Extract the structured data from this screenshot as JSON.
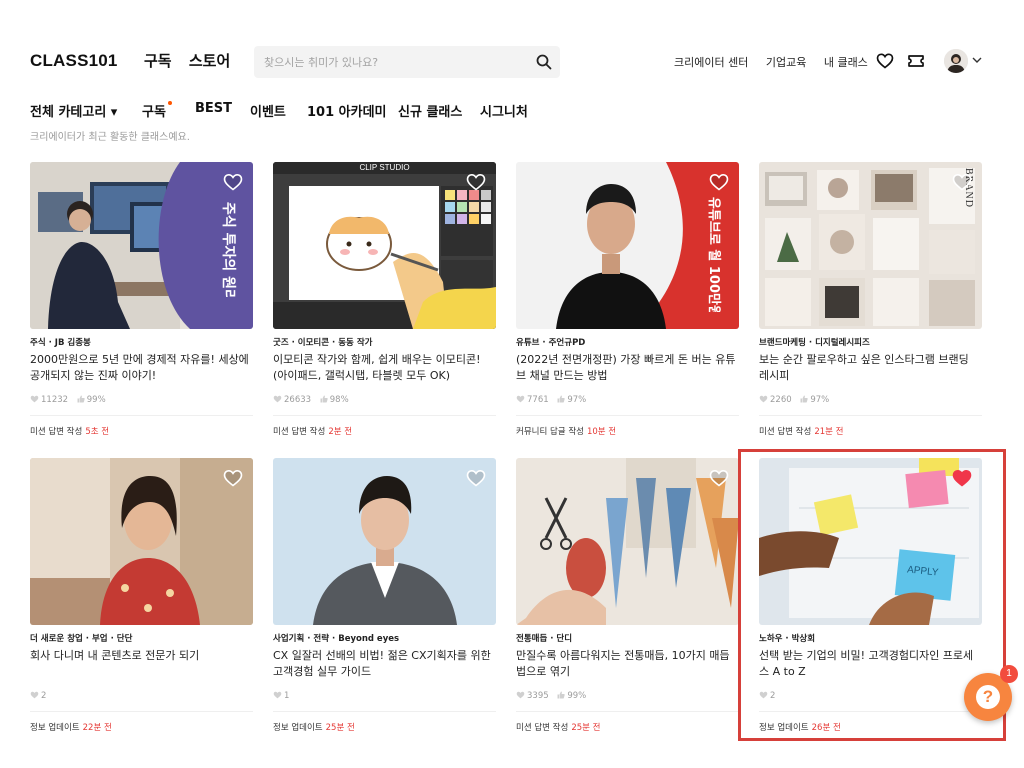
{
  "header": {
    "logo": "CLASS101",
    "nav": [
      "구독",
      "스토어"
    ],
    "search_placeholder": "찾으시는 취미가 있나요?",
    "right_links": [
      "크리에이터 센터",
      "기업교육",
      "내 클래스"
    ]
  },
  "categories": {
    "items": [
      "전체 카테고리 ▾",
      "구독",
      "BEST",
      "이벤트",
      "101 아카데미",
      "신규 클래스",
      "시그니처"
    ],
    "subtitle": "크리에이터가 최근 활동한 클래스예요."
  },
  "cards": [
    {
      "creator": "주식 · JB 김종봉",
      "title": "2000만원으로 5년 만에 경제적 자유를! 세상에 공개되지 않는 진짜 이야기!",
      "likes": "11232",
      "rate": "99%",
      "status": "미션 답변 작성",
      "ago": "5초 전",
      "overlay": "주식 투자의 원리",
      "liked": false
    },
    {
      "creator": "굿즈 · 이모티콘 · 동동 작가",
      "title": "이모티콘 작가와 함께, 쉽게 배우는 이모티콘! (아이패드, 갤럭시탭, 타블렛 모두 OK)",
      "likes": "26633",
      "rate": "98%",
      "status": "미션 답변 작성",
      "ago": "2분 전",
      "overlay": "CLIP STUDIO",
      "liked": false
    },
    {
      "creator": "유튜브 · 주언규PD",
      "title": "(2022년 전면개정판) 가장 빠르게 돈 버는 유튜브 채널 만드는 방법",
      "likes": "7761",
      "rate": "97%",
      "status": "커뮤니티 답글 작성",
      "ago": "10분 전",
      "overlay": "유튜브로 월 100만원",
      "liked": false
    },
    {
      "creator": "브랜드마케팅 · 디지털레시피즈",
      "title": "보는 순간 팔로우하고 싶은 인스타그램 브랜딩 레시피",
      "likes": "2260",
      "rate": "97%",
      "status": "미션 답변 작성",
      "ago": "21분 전",
      "overlay": "BRAND",
      "liked": false
    },
    {
      "creator": "더 새로운 창업 · 부업 · 단단",
      "title": "회사 다니며 내 콘텐츠로 전문가 되기",
      "likes": "2",
      "rate": "",
      "status": "정보 업데이트",
      "ago": "22분 전",
      "overlay": "",
      "liked": false
    },
    {
      "creator": "사업기획 · 전략 · Beyond eyes",
      "title": "CX 일잘러 선배의 비법! 젊은 CX기획자를 위한 고객경험 실무 가이드",
      "likes": "1",
      "rate": "",
      "status": "정보 업데이트",
      "ago": "25분 전",
      "overlay": "",
      "liked": false
    },
    {
      "creator": "전통매듭 · 단디",
      "title": "만질수록 아름다워지는 전통매듭, 10가지 매듭법으로 엮기",
      "likes": "3395",
      "rate": "99%",
      "status": "미션 답변 작성",
      "ago": "25분 전",
      "overlay": "",
      "liked": false
    },
    {
      "creator": "노하우 · 박상회",
      "title": "선택 받는 기업의 비밀! 고객경험디자인 프로세스 A to Z",
      "likes": "2",
      "rate": "",
      "status": "정보 업데이트",
      "ago": "26분 전",
      "overlay": "APPLY",
      "liked": true
    }
  ],
  "help": {
    "icon": "?",
    "badge": "1"
  },
  "colors": {
    "accent": "#ff5600",
    "time_red": "#e53935",
    "highlight": "#d6403a",
    "help": "#f7853f"
  }
}
